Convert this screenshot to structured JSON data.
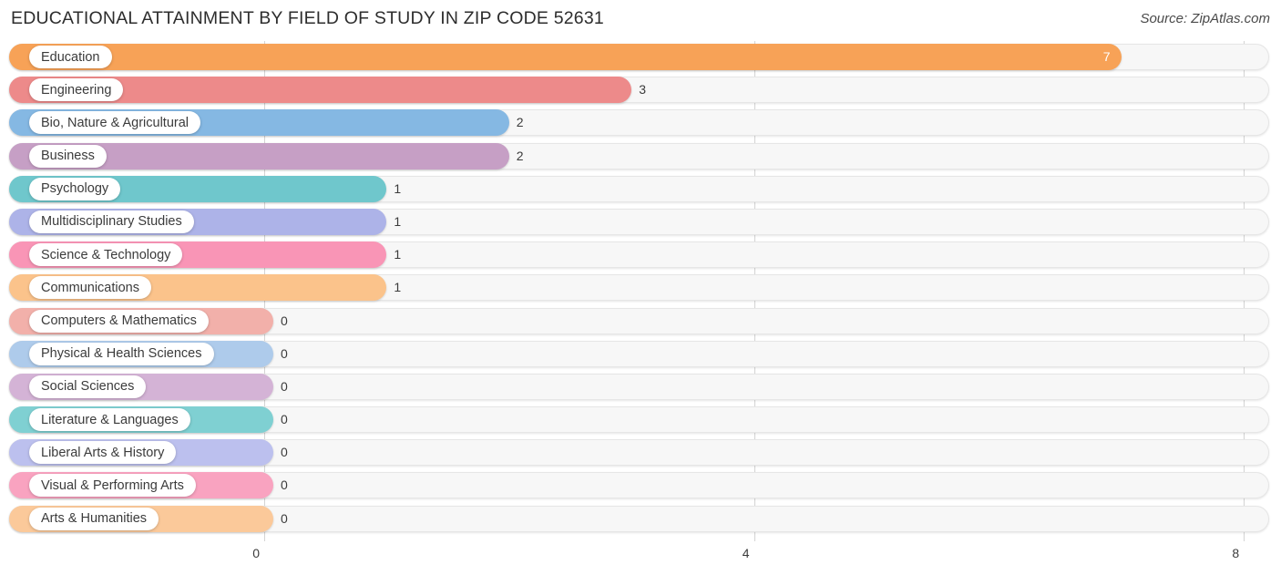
{
  "header": {
    "title": "EDUCATIONAL ATTAINMENT BY FIELD OF STUDY IN ZIP CODE 52631",
    "source": "Source: ZipAtlas.com"
  },
  "chart_data": {
    "type": "bar",
    "orientation": "horizontal",
    "title": "EDUCATIONAL ATTAINMENT BY FIELD OF STUDY IN ZIP CODE 52631",
    "xlabel": "",
    "ylabel": "",
    "xlim": [
      0,
      8
    ],
    "xticks": [
      "0",
      "4",
      "8"
    ],
    "xtick_values": [
      0,
      4,
      8
    ],
    "grid": true,
    "legend": "none",
    "categories": [
      "Education",
      "Engineering",
      "Bio, Nature & Agricultural",
      "Business",
      "Psychology",
      "Multidisciplinary Studies",
      "Science & Technology",
      "Communications",
      "Computers & Mathematics",
      "Physical & Health Sciences",
      "Social Sciences",
      "Literature & Languages",
      "Liberal Arts & History",
      "Visual & Performing Arts",
      "Arts & Humanities"
    ],
    "values": [
      7,
      3,
      2,
      2,
      1,
      1,
      1,
      1,
      0,
      0,
      0,
      0,
      0,
      0,
      0
    ],
    "value_labels": [
      "7",
      "3",
      "2",
      "2",
      "1",
      "1",
      "1",
      "1",
      "0",
      "0",
      "0",
      "0",
      "0",
      "0",
      "0"
    ],
    "colors": [
      "#f7a257",
      "#ed8a8a",
      "#85b8e3",
      "#c69fc5",
      "#6fc7cc",
      "#adb3e8",
      "#f995b6",
      "#fbc38b",
      "#f2b0aa",
      "#aecbeb",
      "#d4b3d6",
      "#7fd0d2",
      "#bcc0ee",
      "#f9a3c0",
      "#fbc99a"
    ]
  }
}
